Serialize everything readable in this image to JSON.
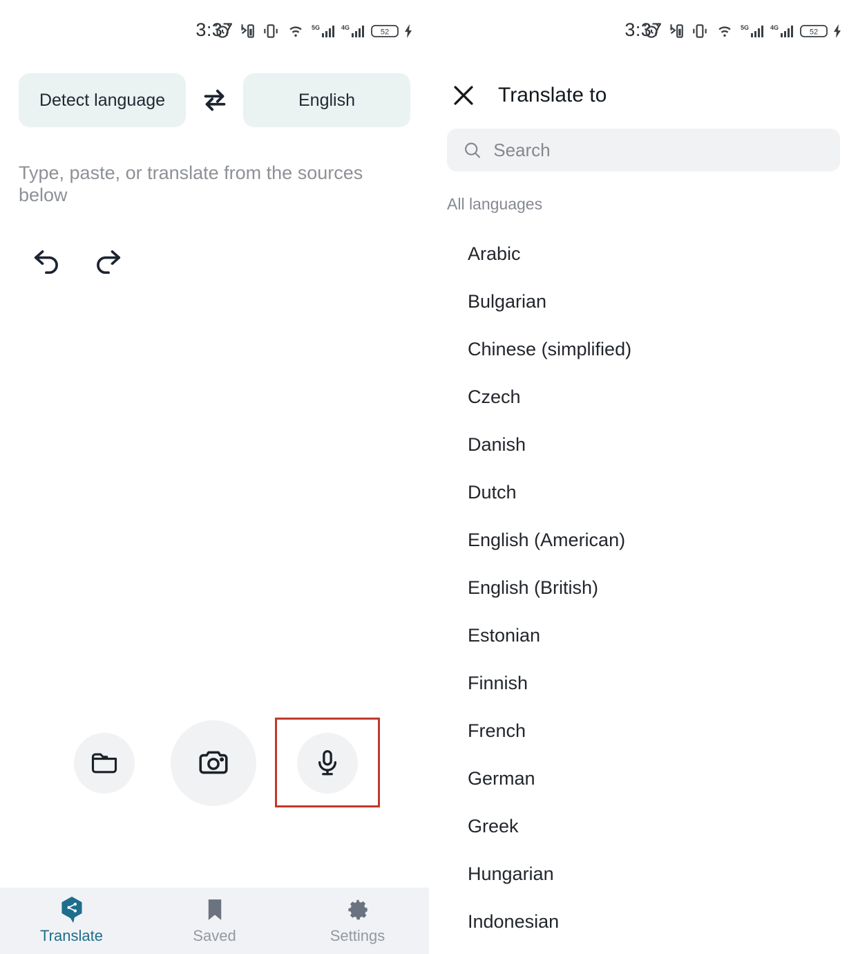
{
  "status_bar": {
    "time": "3:37",
    "battery_percent": "52",
    "network_5g": "5G",
    "network_4g": "4G",
    "icons": [
      "alarm-icon",
      "bluetooth-battery-icon",
      "vibrate-icon",
      "wifi-icon",
      "signal-5g-icon",
      "signal-4g-icon",
      "battery-icon",
      "charging-bolt-icon"
    ]
  },
  "left_panel": {
    "source_language": "Detect language",
    "target_language": "English",
    "swap_icon": "swap-horizontal-icon",
    "input_placeholder": "Type, paste, or translate from the sources below",
    "undo_icon": "undo-icon",
    "redo_icon": "redo-icon",
    "actions": [
      {
        "name": "folder",
        "icon": "folder-icon",
        "label": "Open file"
      },
      {
        "name": "camera",
        "icon": "camera-icon",
        "label": "Camera"
      },
      {
        "name": "microphone",
        "icon": "microphone-icon",
        "label": "Voice input"
      }
    ],
    "highlighted_action": "microphone",
    "highlight_color": "#c0392b",
    "nav": [
      {
        "label": "Translate",
        "icon": "translate-hexagon-icon",
        "active": true
      },
      {
        "label": "Saved",
        "icon": "bookmark-icon",
        "active": false
      },
      {
        "label": "Settings",
        "icon": "gear-icon",
        "active": false
      }
    ]
  },
  "right_panel": {
    "title": "Translate to",
    "close_icon": "close-icon",
    "search": {
      "placeholder": "Search",
      "value": "",
      "icon": "search-icon"
    },
    "section_label": "All languages",
    "languages": [
      "Arabic",
      "Bulgarian",
      "Chinese (simplified)",
      "Czech",
      "Danish",
      "Dutch",
      "English (American)",
      "English (British)",
      "Estonian",
      "Finnish",
      "French",
      "German",
      "Greek",
      "Hungarian",
      "Indonesian"
    ]
  },
  "colors": {
    "pill_background": "#eaf2f2",
    "accent_blue": "#1d6e8c",
    "nav_background": "#f1f2f5",
    "circle_background": "#f1f2f4",
    "muted_text": "#85898f"
  }
}
